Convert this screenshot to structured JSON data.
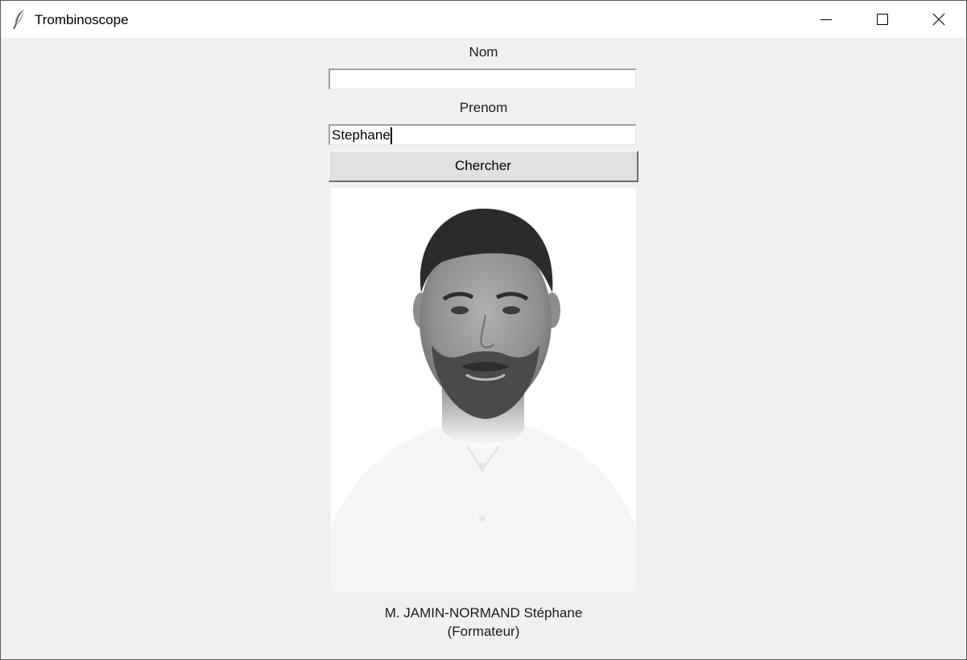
{
  "window": {
    "title": "Trombinoscope",
    "icon": "feather-icon",
    "controls": [
      "minimize-icon",
      "maximize-icon",
      "close-icon"
    ]
  },
  "form": {
    "nom_label": "Nom",
    "nom_value": "",
    "prenom_label": "Prenom",
    "prenom_value": "Stephane",
    "search_button": "Chercher"
  },
  "result": {
    "photo": "portrait-photo",
    "name": "M. JAMIN-NORMAND Stéphane",
    "role": "(Formateur)"
  }
}
